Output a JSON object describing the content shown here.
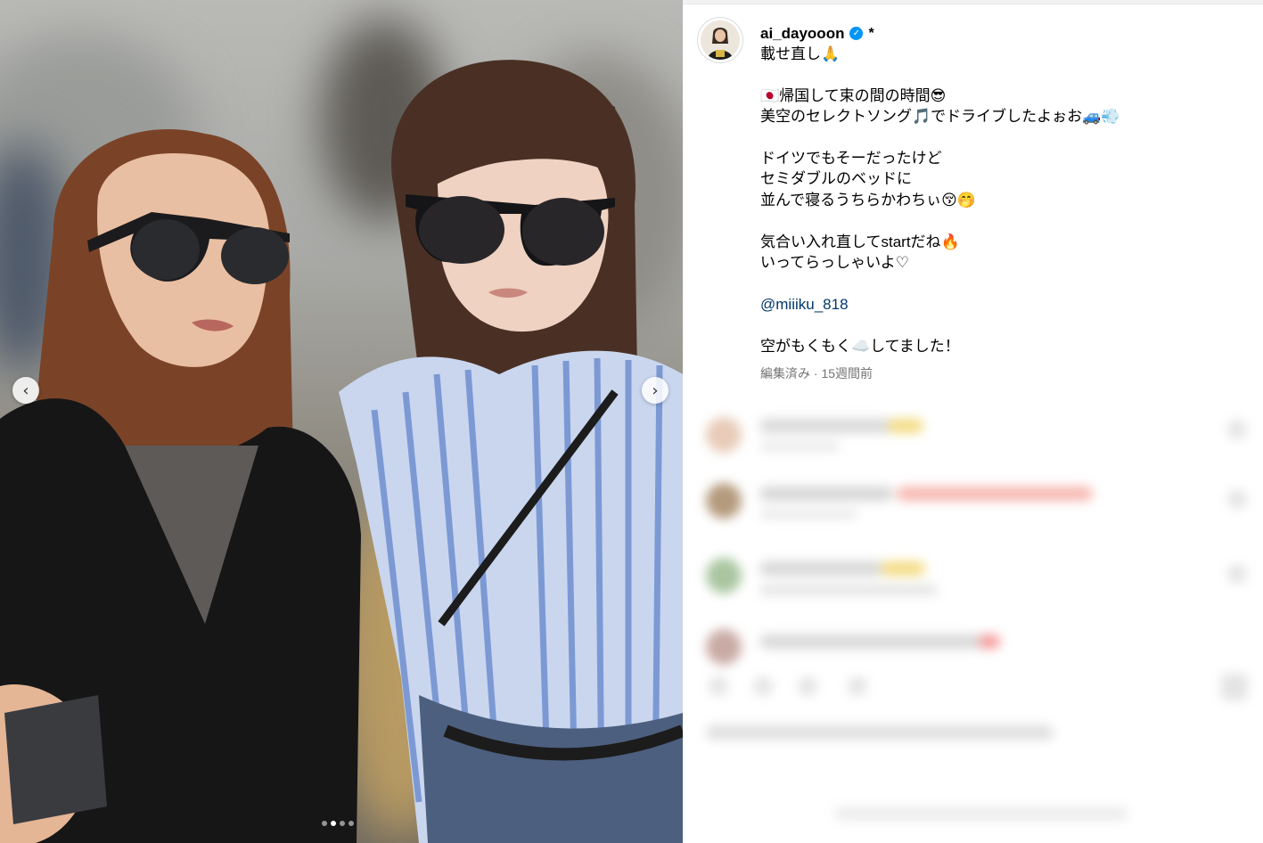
{
  "post": {
    "username": "ai_dayooon",
    "verified_icon": "verified-badge-icon",
    "extra_mark": "*",
    "caption_lines": [
      "載せ直し🙏",
      "",
      "🇯🇵帰国して束の間の時間😎",
      "美空のセレクトソング🎵でドライブしたよぉお🚙💨",
      "",
      "ドイツでもそーだったけど",
      "セミダブルのベッドに",
      "並んで寝るうちらかわちぃ😚🤭",
      "",
      "気合い入れ直してstartだね🔥",
      "いってらっしゃいよ♡",
      "",
      "@miiiku_818",
      "",
      "空がもくもく☁️してました！"
    ],
    "mention": "@miiiku_818",
    "edited_meta": "編集済み · 15週間前"
  },
  "carousel": {
    "prev_icon": "‹",
    "next_icon": "›",
    "slide_count": 4,
    "active_index": 1
  },
  "colors": {
    "accent": "#0095f6",
    "mention": "#00376b",
    "meta_gray": "#737373"
  }
}
